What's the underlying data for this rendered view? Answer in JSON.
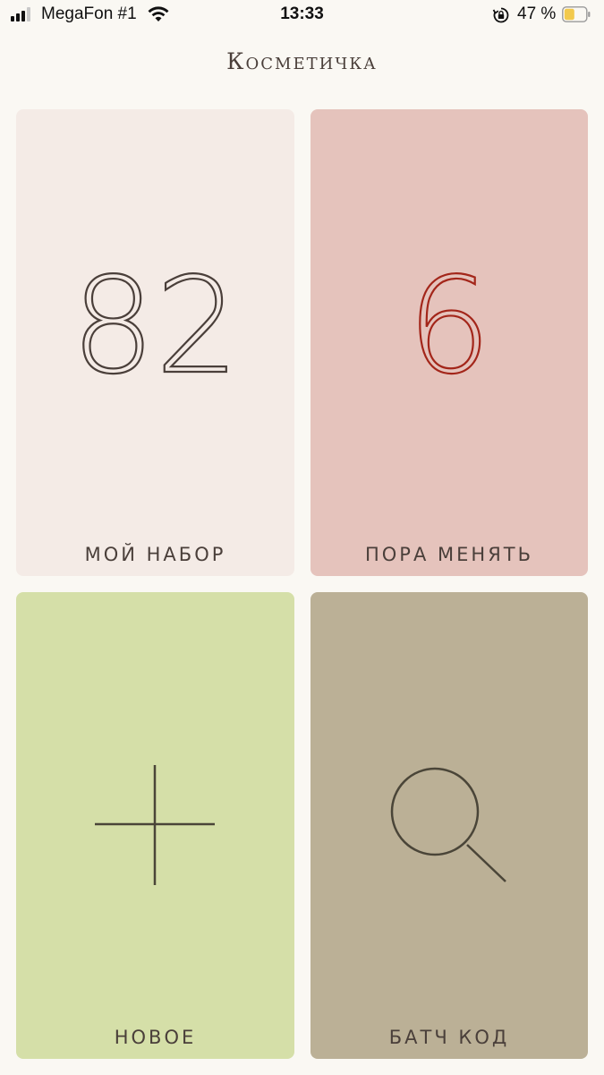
{
  "status_bar": {
    "carrier": "MegaFon #1",
    "time": "13:33",
    "battery_percent": "47 %",
    "battery_level": 0.47,
    "battery_color": "#f2c94c",
    "icons": [
      "signal-icon",
      "wifi-icon",
      "orientation-lock-icon",
      "battery-icon"
    ]
  },
  "app": {
    "title": "Косметичка"
  },
  "tiles": {
    "my_set": {
      "count": "82",
      "label": "МОЙ НАБОР",
      "color": "#f4ebe6"
    },
    "replace": {
      "count": "6",
      "label": "ПОРА МЕНЯТЬ",
      "color": "#e5c3bc",
      "number_color": "#a3261a"
    },
    "new": {
      "label": "НОВОЕ",
      "icon": "plus-icon",
      "color": "#d5dfa8"
    },
    "batch_code": {
      "label": "БАТЧ КОД",
      "icon": "search-icon",
      "color": "#bbb096"
    }
  }
}
